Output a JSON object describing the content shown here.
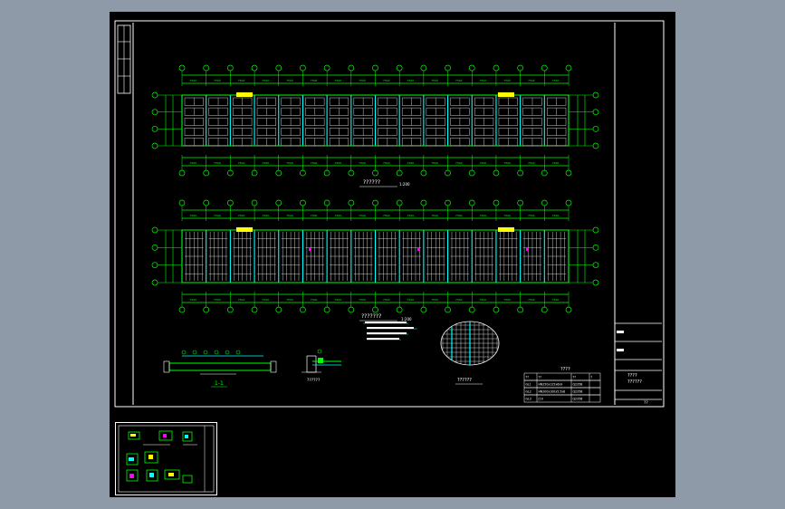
{
  "drawing": {
    "plan1_title": "??????",
    "plan1_scale": "1:200",
    "plan2_title": "???????",
    "plan2_scale": "1:200",
    "section_label": "1-1",
    "detail_label": "??????",
    "circle_label": "??????",
    "table_title": "????",
    "table_headers": [
      "??",
      "??",
      "??",
      "?"
    ],
    "table_rows": [
      [
        "GL1",
        "HN250x125x6x9",
        "Q235B",
        ""
      ],
      [
        "GL2",
        "HN200x100x5.5x8",
        "Q235B",
        ""
      ],
      [
        "GL3",
        "[10",
        "Q235B",
        ""
      ]
    ],
    "title_block": {
      "line1": "????",
      "line2": "??????",
      "drawing_no": "??"
    },
    "top_axis_labels": [
      "1",
      "2",
      "3",
      "4",
      "5",
      "6",
      "7",
      "8",
      "9",
      "10",
      "11",
      "12",
      "13",
      "14",
      "15",
      "16",
      "17"
    ],
    "left_axis_labels": [
      "A",
      "B",
      "C",
      "D"
    ]
  },
  "colors": {
    "frame": "#ffffff",
    "axis": "#00ff00",
    "beam": "#00ffff",
    "grid": "#c8c8c8",
    "highlight": "#ffff00",
    "accent": "#ff00ff"
  },
  "thumbnail": {
    "visible": true
  }
}
